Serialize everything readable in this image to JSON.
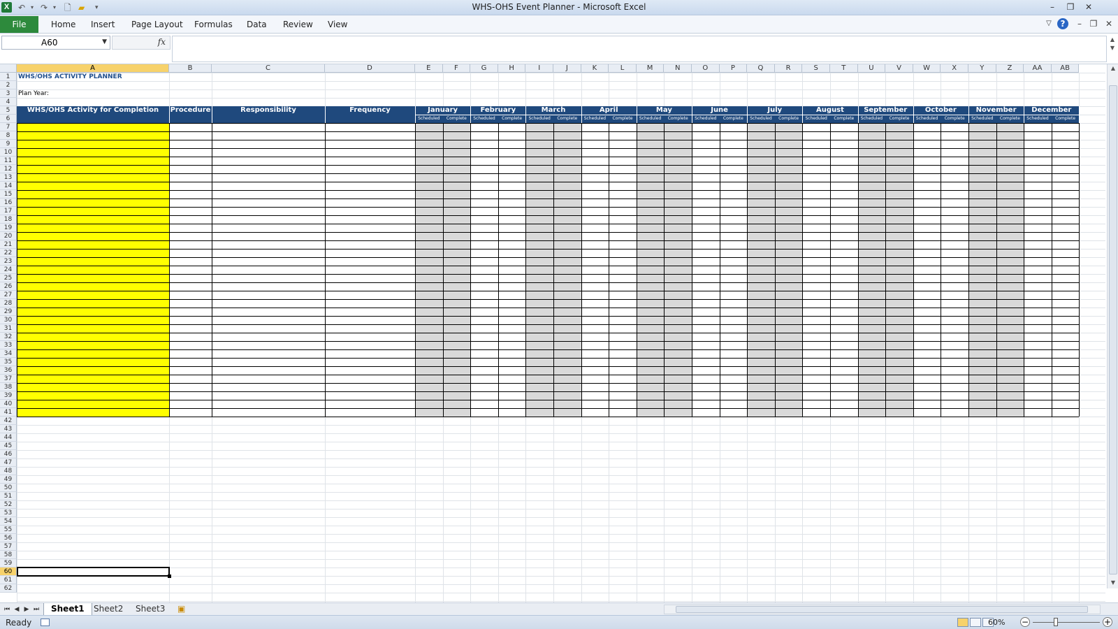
{
  "app": {
    "window_title": "WHS-OHS Event Planner  -  Microsoft Excel",
    "icon_letter": "X"
  },
  "ribbon": {
    "file_label": "File",
    "tabs": [
      "Home",
      "Insert",
      "Page Layout",
      "Formulas",
      "Data",
      "Review",
      "View"
    ]
  },
  "formula_bar": {
    "name_box": "A60",
    "fx_symbol": "fx",
    "formula": ""
  },
  "columns": [
    "A",
    "B",
    "C",
    "D",
    "E",
    "F",
    "G",
    "H",
    "I",
    "J",
    "K",
    "L",
    "M",
    "N",
    "O",
    "P",
    "Q",
    "R",
    "S",
    "T",
    "U",
    "V",
    "W",
    "X",
    "Y",
    "Z",
    "AA",
    "AB"
  ],
  "selected_column": "A",
  "rows_visible": {
    "first": 1,
    "last": 62,
    "selected": 60
  },
  "sheet": {
    "title": "WHS/OHS ACTIVITY PLANNER",
    "plan_year_label": "Plan Year:",
    "headers": {
      "activity": "WHS/OHS Activity for Completion",
      "procedure": "Procedure",
      "responsibility": "Responsibility",
      "frequency": "Frequency"
    },
    "months": [
      "January",
      "February",
      "March",
      "April",
      "May",
      "June",
      "July",
      "August",
      "September",
      "October",
      "November",
      "December"
    ],
    "sub_headers": {
      "scheduled": "Scheduled",
      "complete": "Complete"
    },
    "table_rows": {
      "first": 7,
      "last": 41
    }
  },
  "colors": {
    "header_band": "#1f497d",
    "activity_fill": "#ffff00",
    "scheduled_fill": "#d9d9d9",
    "file_tab": "#2d8a3c",
    "title_text": "#1f4e8c"
  },
  "sheet_tabs": [
    "Sheet1",
    "Sheet2",
    "Sheet3"
  ],
  "active_sheet": "Sheet1",
  "status": {
    "mode": "Ready",
    "zoom": "60%"
  }
}
